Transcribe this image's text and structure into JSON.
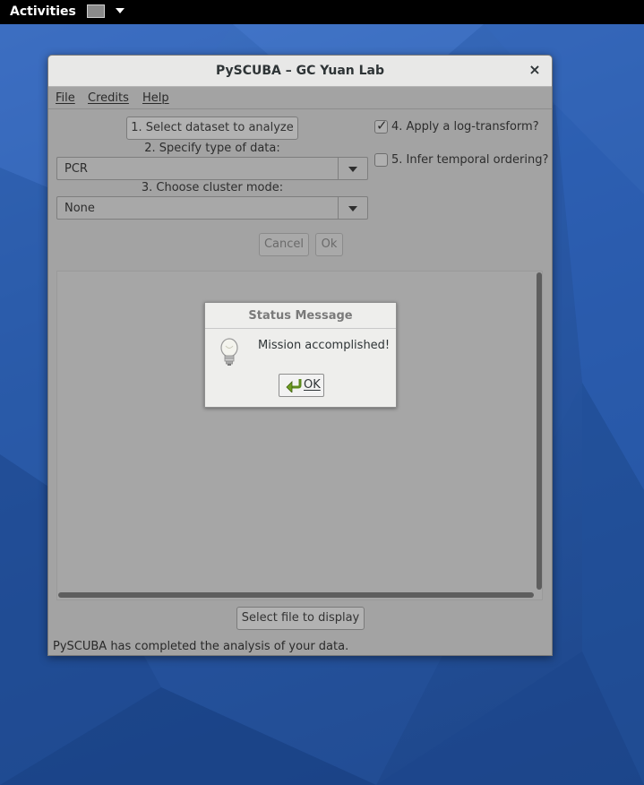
{
  "topbar": {
    "activities_label": "Activities"
  },
  "window": {
    "title": "PySCUBA – GC Yuan Lab",
    "close_glyph": "×"
  },
  "menubar": {
    "items": [
      {
        "label": "File"
      },
      {
        "label": "Credits"
      },
      {
        "label": "Help"
      }
    ]
  },
  "controls": {
    "select_dataset_button": "1. Select dataset to analyze",
    "data_type_label": "2. Specify type of data:",
    "data_type_value": "PCR",
    "cluster_mode_label": "3. Choose cluster mode:",
    "cluster_mode_value": "None",
    "log_transform_label": "4. Apply a log-transform?",
    "log_transform_checked": true,
    "temporal_label": "5. Infer temporal ordering?",
    "temporal_checked": false,
    "cancel_button": "Cancel",
    "ok_button": "Ok",
    "select_file_button": "Select file to display"
  },
  "status_bar": {
    "text": "PySCUBA has completed the analysis of your data."
  },
  "dialog": {
    "title": "Status Message",
    "message": "Mission accomplished!",
    "ok_label": "OK",
    "icon": "lightbulb-icon"
  },
  "colors": {
    "desktop_blue": "#2b5cab",
    "topbar": "#000000",
    "dimmed_window": "#a3a3a3",
    "dialog_bg": "#eeeeec"
  }
}
